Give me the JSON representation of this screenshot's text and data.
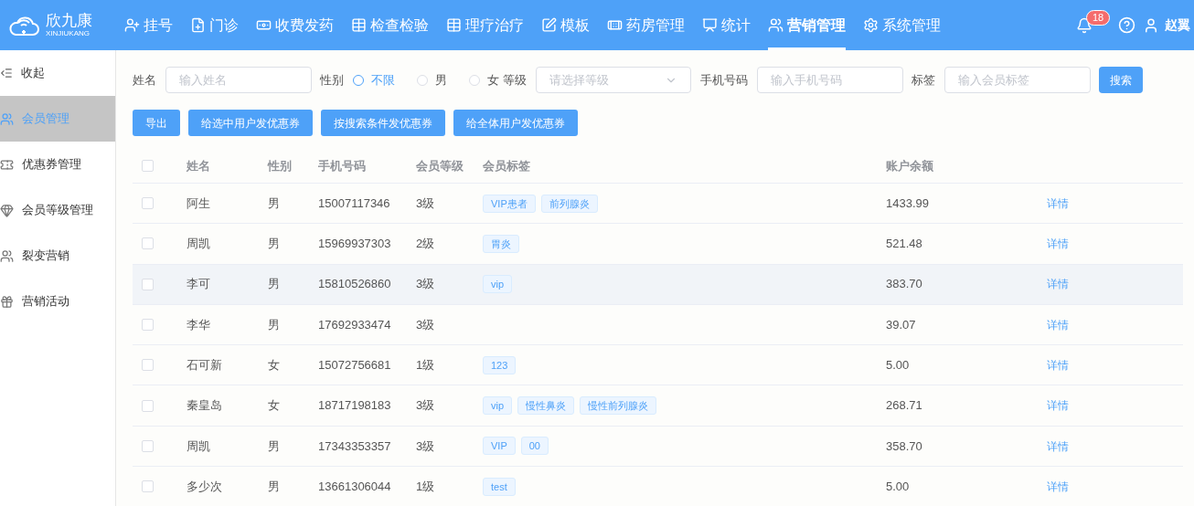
{
  "brand": {
    "name": "欣九康",
    "subtitle": "XINJIUKANG"
  },
  "nav": [
    {
      "label": "挂号",
      "selected": false
    },
    {
      "label": "门诊",
      "selected": false
    },
    {
      "label": "收费发药",
      "selected": false
    },
    {
      "label": "检查检验",
      "selected": false
    },
    {
      "label": "理疗治疗",
      "selected": false
    },
    {
      "label": "模板",
      "selected": false
    },
    {
      "label": "药房管理",
      "selected": false
    },
    {
      "label": "统计",
      "selected": false
    },
    {
      "label": "营销管理",
      "selected": true
    },
    {
      "label": "系统管理",
      "selected": false
    }
  ],
  "notifications": {
    "count": "18"
  },
  "user": {
    "name": "赵翼"
  },
  "sidebar": {
    "collapse": "收起",
    "items": [
      {
        "label": "会员管理",
        "selected": true
      },
      {
        "label": "优惠券管理",
        "selected": false
      },
      {
        "label": "会员等级管理",
        "selected": false
      },
      {
        "label": "裂变营销",
        "selected": false
      },
      {
        "label": "营销活动",
        "selected": false
      }
    ]
  },
  "filters": {
    "name": {
      "label": "姓名",
      "placeholder": "输入姓名"
    },
    "gender": {
      "label": "性别",
      "options": [
        {
          "label": "不限",
          "selected": true
        },
        {
          "label": "男",
          "selected": false
        },
        {
          "label": "女",
          "selected": false
        }
      ]
    },
    "level": {
      "label": "等级",
      "placeholder": "请选择等级"
    },
    "phone": {
      "label": "手机号码",
      "placeholder": "输入手机号码"
    },
    "tag": {
      "label": "标签",
      "placeholder": "输入会员标签"
    },
    "search": "搜索"
  },
  "actions": [
    "导出",
    "给选中用户发优惠券",
    "按搜索条件发优惠券",
    "给全体用户发优惠券"
  ],
  "table": {
    "all_checked": false,
    "columns": [
      "姓名",
      "性别",
      "手机号码",
      "会员等级",
      "会员标签",
      "账户余额"
    ],
    "rows": [
      {
        "name": "阿生",
        "gender": "男",
        "phone": "15007117346",
        "level": "3级",
        "tags": [
          "VIP患者",
          "前列腺炎"
        ],
        "balance": "1433.99",
        "action": "详情",
        "checked": false,
        "hovered": false
      },
      {
        "name": "周凯",
        "gender": "男",
        "phone": "15969937303",
        "level": "2级",
        "tags": [
          "胃炎"
        ],
        "balance": "521.48",
        "action": "详情",
        "checked": false,
        "hovered": false
      },
      {
        "name": "李可",
        "gender": "男",
        "phone": "15810526860",
        "level": "3级",
        "tags": [
          "vip"
        ],
        "balance": "383.70",
        "action": "详情",
        "checked": false,
        "hovered": true
      },
      {
        "name": "李华",
        "gender": "男",
        "phone": "17692933474",
        "level": "3级",
        "tags": [],
        "balance": "39.07",
        "action": "详情",
        "checked": false,
        "hovered": false
      },
      {
        "name": "石可新",
        "gender": "女",
        "phone": "15072756681",
        "level": "1级",
        "tags": [
          "123"
        ],
        "balance": "5.00",
        "action": "详情",
        "checked": false,
        "hovered": false
      },
      {
        "name": "秦皇岛",
        "gender": "女",
        "phone": "18717198183",
        "level": "3级",
        "tags": [
          "vip",
          "慢性鼻炎",
          "慢性前列腺炎"
        ],
        "balance": "268.71",
        "action": "详情",
        "checked": false,
        "hovered": false
      },
      {
        "name": "周凯",
        "gender": "男",
        "phone": "17343353357",
        "level": "3级",
        "tags": [
          "VIP",
          "00"
        ],
        "balance": "358.70",
        "action": "详情",
        "checked": false,
        "hovered": false
      },
      {
        "name": "多少次",
        "gender": "男",
        "phone": "13661306044",
        "level": "1级",
        "tags": [
          "test"
        ],
        "balance": "5.00",
        "action": "详情",
        "checked": false,
        "hovered": false
      }
    ]
  }
}
